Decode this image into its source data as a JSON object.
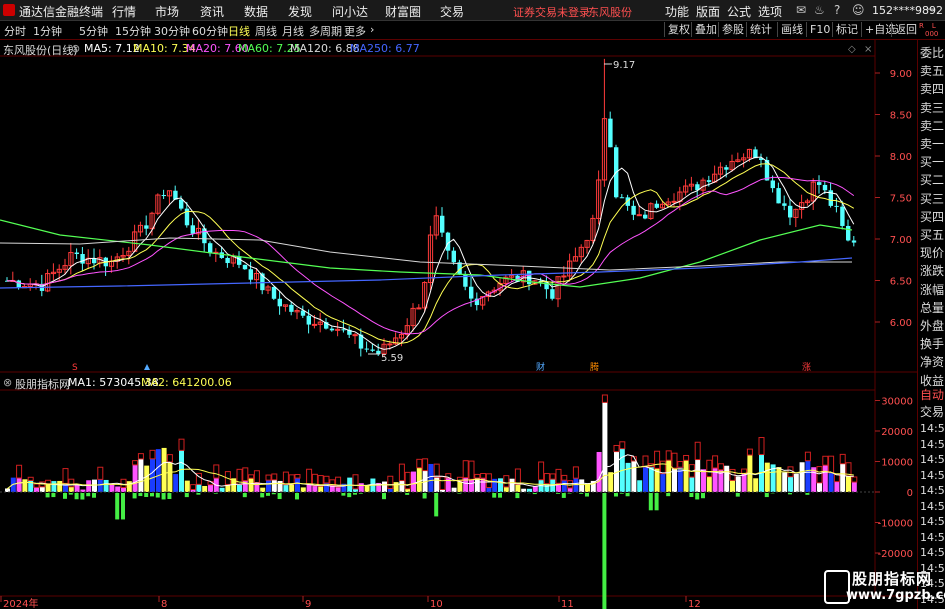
{
  "app": {
    "name": "通达信金融终端",
    "user": "152****9892"
  },
  "menu": {
    "items": [
      "行情",
      "市场",
      "资讯",
      "数据",
      "发现",
      "问小达",
      "财富圈",
      "交易"
    ],
    "warn": "证券交易未登录",
    "stock": "东风股份",
    "right": [
      "功能",
      "版面",
      "公式",
      "选项"
    ]
  },
  "toolbar": {
    "periods": [
      "分时",
      "1分钟",
      "5分钟",
      "15分钟",
      "30分钟",
      "60分钟",
      "日线",
      "周线",
      "月线",
      "多周期",
      "更多"
    ],
    "active": "日线",
    "right": [
      "复权",
      "叠加",
      "参股",
      "统计",
      "画线",
      "F10",
      "标记",
      "+自选",
      "返回"
    ]
  },
  "main_header": {
    "title": "东风股份(日线)",
    "ma": [
      {
        "label": "MA5: 7.12",
        "color": "#ffffff"
      },
      {
        "label": "MA10: 7.34",
        "color": "#ffff54"
      },
      {
        "label": "MA20: 7.60",
        "color": "#ff54ff"
      },
      {
        "label": "MA60: 7.25",
        "color": "#54ff54"
      },
      {
        "label": "MA120: 6.88",
        "color": "#d8d8d8"
      },
      {
        "label": "MA250: 6.77",
        "color": "#4466ff"
      }
    ]
  },
  "sub_header": {
    "title": "股朋指标网",
    "ma": [
      {
        "label": "MA1: 573045.38",
        "color": "#ffffff"
      },
      {
        "label": "MA2: 641200.06",
        "color": "#ffff54"
      }
    ]
  },
  "annotations": {
    "high": "9.17",
    "low": "5.59",
    "marks": [
      "S",
      "财",
      "腾",
      "涨"
    ]
  },
  "price_axis": [
    "9.00",
    "8.50",
    "8.00",
    "7.50",
    "7.00",
    "6.50",
    "6.00"
  ],
  "sub_axis": [
    "30000",
    "20000",
    "10000",
    "0",
    "-10000",
    "-20000"
  ],
  "date_axis": [
    "2024年",
    "8",
    "9",
    "10",
    "11",
    "12"
  ],
  "sidebar": {
    "top": [
      "R",
      "L",
      "000"
    ],
    "items": [
      "委比",
      "卖五",
      "卖四",
      "卖三",
      "卖二",
      "卖一",
      "买一",
      "买二",
      "买三",
      "买四",
      "买五",
      "现价",
      "涨跌",
      "涨幅",
      "总量",
      "外盘",
      "换手",
      "净资",
      "收益"
    ],
    "auto": "自动",
    "trade": "交易",
    "times": [
      "14:56",
      "14:56",
      "14:56",
      "14:56",
      "14:56",
      "14:56",
      "14:56",
      "14:56",
      "14:56",
      "14:56",
      "14:56",
      "14:56"
    ]
  },
  "watermark": {
    "name": "股朋指标网",
    "url": "www.7gpzb.com"
  },
  "colors": {
    "up": "#ff3b3b",
    "down": "#54ffff",
    "ma5": "#ffffff",
    "ma10": "#ffff54",
    "ma20": "#ff54ff",
    "ma60": "#54ff54",
    "ma120": "#d8d8d8",
    "ma250": "#4466ff",
    "grid": "#5a0000"
  }
}
